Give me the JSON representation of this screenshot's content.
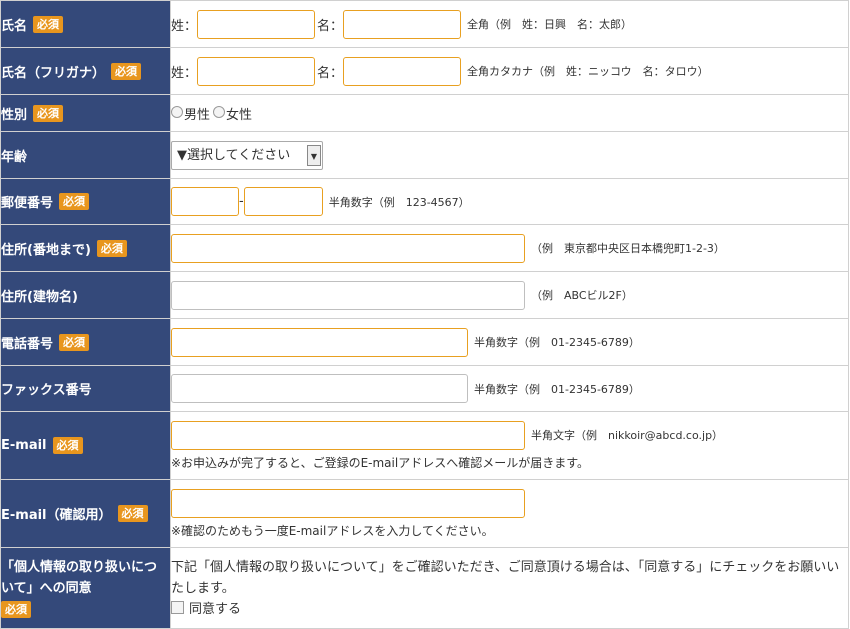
{
  "required_badge": "必須",
  "rows": {
    "name": {
      "label": "氏名",
      "sei_prefix": "姓：",
      "mei_prefix": "名：",
      "hint": "全角（例　姓：日興　名：太郎）"
    },
    "kana": {
      "label": "氏名（フリガナ）",
      "sei_prefix": "姓：",
      "mei_prefix": "名：",
      "hint": "全角カタカナ（例　姓：ニッコウ　名：タロウ）"
    },
    "gender": {
      "label": "性別",
      "options": [
        "男性",
        "女性"
      ]
    },
    "age": {
      "label": "年齢",
      "selected": "▼選択してください"
    },
    "zip": {
      "label": "郵便番号",
      "separator": "-",
      "hint": "半角数字（例　123-4567）"
    },
    "address": {
      "label": "住所(番地まで)",
      "hint": "（例　東京都中央区日本橋兜町1-2-3）"
    },
    "building": {
      "label": "住所(建物名)",
      "hint": "（例　ABCビル2F）"
    },
    "phone": {
      "label": "電話番号",
      "hint": "半角数字（例　01-2345-6789）"
    },
    "fax": {
      "label": "ファックス番号",
      "hint": "半角数字（例　01-2345-6789）"
    },
    "email": {
      "label": "E-mail",
      "hint": "半角文字（例　nikkoir@abcd.co.jp）",
      "note": "※お申込みが完了すると、ご登録のE-mailアドレスへ確認メールが届きます。"
    },
    "email_confirm": {
      "label": "E-mail（確認用）",
      "note": "※確認のためもう一度E-mailアドレスを入力してください。"
    },
    "privacy": {
      "label": "「個人情報の取り扱いについて」への同意",
      "text": "下記「個人情報の取り扱いについて」をご確認いただき、ご同意頂ける場合は、「同意する」にチェックをお願いいたします。",
      "checkbox_label": "同意する"
    }
  },
  "colors": {
    "label_bg": "#34497a",
    "badge": "#e8961e",
    "input_border": "#e8a021"
  }
}
